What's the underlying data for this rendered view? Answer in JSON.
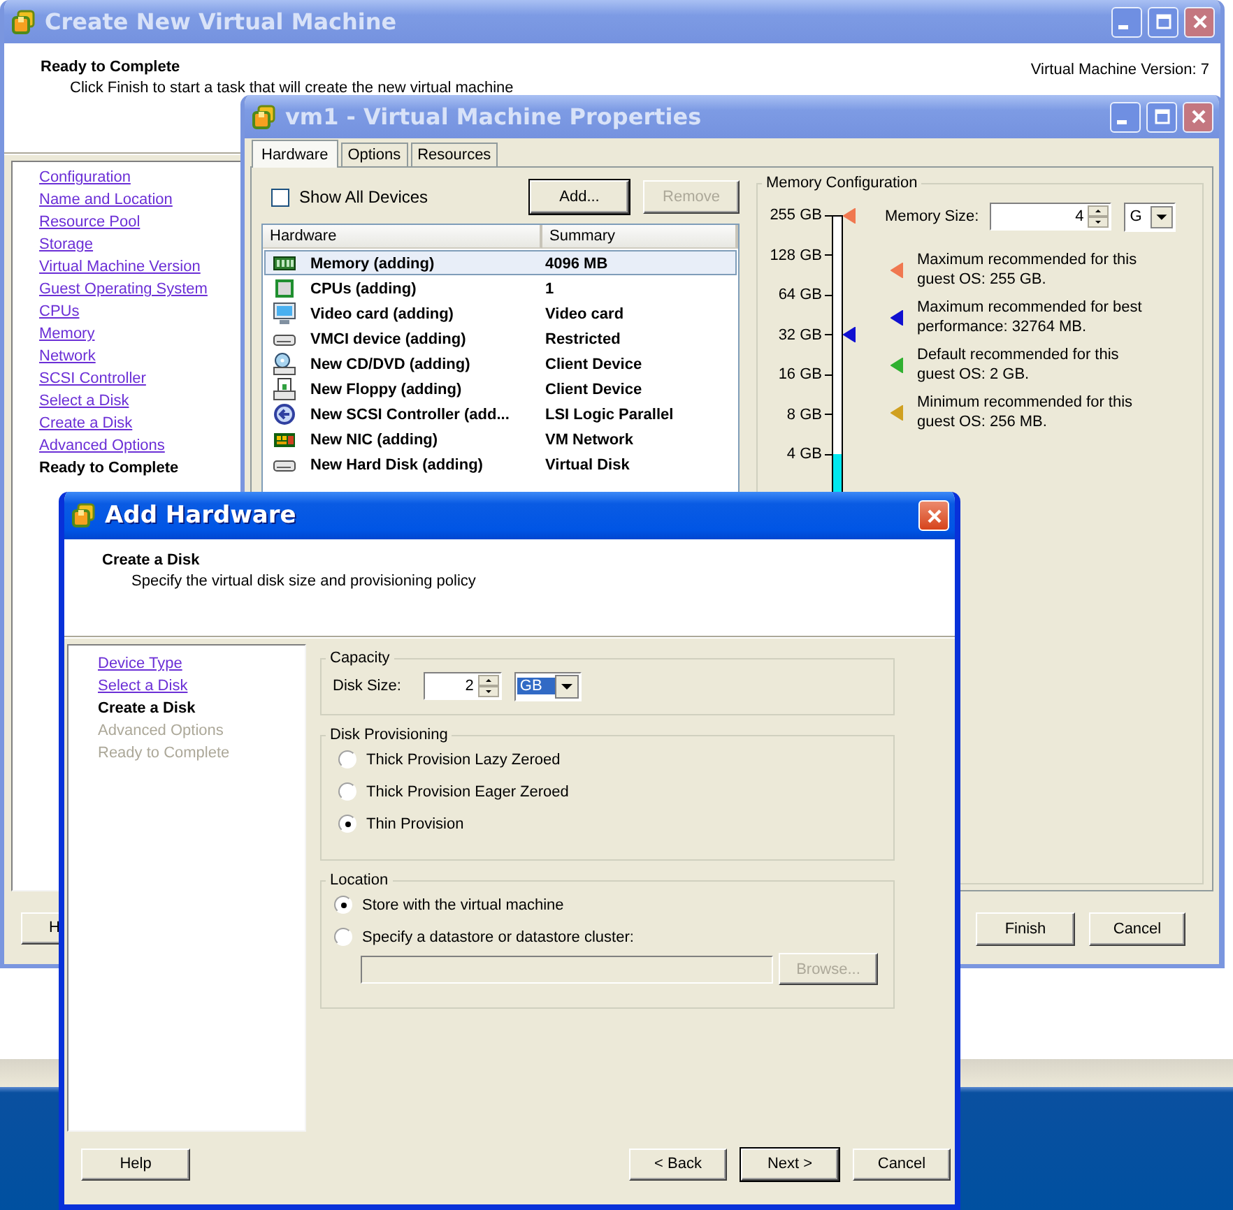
{
  "create_wizard": {
    "title": "Create New Virtual Machine",
    "active": false,
    "controls": [
      {
        "kind": "minimize"
      },
      {
        "kind": "maximize"
      },
      {
        "kind": "close"
      }
    ],
    "header": {
      "title": "Ready to Complete",
      "subtitle": "Click Finish to start a task that will create the new virtual machine",
      "version": "Virtual Machine Version: 7"
    },
    "steps": [
      {
        "label": "Configuration",
        "selected": false,
        "disabled": false
      },
      {
        "label": "Name and Location",
        "selected": false,
        "disabled": false
      },
      {
        "label": "Resource Pool",
        "selected": false,
        "disabled": false
      },
      {
        "label": "Storage",
        "selected": false,
        "disabled": false
      },
      {
        "label": "Virtual Machine Version",
        "selected": false,
        "disabled": false
      },
      {
        "label": "Guest Operating System",
        "selected": false,
        "disabled": false
      },
      {
        "label": "CPUs",
        "selected": false,
        "disabled": false
      },
      {
        "label": "Memory",
        "selected": false,
        "disabled": false
      },
      {
        "label": "Network",
        "selected": false,
        "disabled": false
      },
      {
        "label": "SCSI Controller",
        "selected": false,
        "disabled": false
      },
      {
        "label": "Select a Disk",
        "selected": false,
        "disabled": false
      },
      {
        "label": "Create a Disk",
        "selected": false,
        "disabled": false
      },
      {
        "label": "Advanced Options",
        "selected": false,
        "disabled": false
      },
      {
        "label": "Ready to Complete",
        "selected": true,
        "disabled": false
      }
    ],
    "buttons": [
      {
        "label": "H",
        "disabled": false,
        "default": false
      }
    ]
  },
  "properties": {
    "title": "vm1 - Virtual Machine Properties",
    "active": false,
    "controls": [
      {
        "kind": "minimize"
      },
      {
        "kind": "maximize"
      },
      {
        "kind": "close"
      }
    ],
    "tabs": [
      {
        "label": "Hardware",
        "selected": true
      },
      {
        "label": "Options",
        "selected": false
      },
      {
        "label": "Resources",
        "selected": false
      }
    ],
    "show_all_devices": {
      "label": "Show All Devices",
      "checked": false
    },
    "add_button": {
      "label": "Add...",
      "disabled": false,
      "default": true
    },
    "remove_button": {
      "label": "Remove",
      "disabled": true,
      "default": false
    },
    "table": {
      "columns": [
        "Hardware",
        "Summary"
      ],
      "rows": [
        {
          "kind": "memory",
          "hardware": "Memory (adding)",
          "summary": "4096 MB",
          "selected": true
        },
        {
          "kind": "cpu",
          "hardware": "CPUs (adding)",
          "summary": "1",
          "selected": false
        },
        {
          "kind": "video",
          "hardware": "Video card  (adding)",
          "summary": "Video card",
          "selected": false
        },
        {
          "kind": "vmci",
          "hardware": "VMCI device (adding)",
          "summary": "Restricted",
          "selected": false
        },
        {
          "kind": "cdrom",
          "hardware": "New CD/DVD (adding)",
          "summary": "Client Device",
          "selected": false
        },
        {
          "kind": "floppy",
          "hardware": "New Floppy (adding)",
          "summary": "Client Device",
          "selected": false
        },
        {
          "kind": "scsi",
          "hardware": "New SCSI Controller (add...",
          "summary": "LSI Logic Parallel",
          "selected": false
        },
        {
          "kind": "nic",
          "hardware": "New NIC (adding)",
          "summary": "VM Network",
          "selected": false
        },
        {
          "kind": "disk",
          "hardware": "New Hard Disk (adding)",
          "summary": "Virtual Disk",
          "selected": false
        }
      ]
    },
    "memory": {
      "title": "Memory Configuration",
      "ticks": [
        {
          "label": "255 GB",
          "color": "#f07850"
        },
        {
          "label": "128 GB"
        },
        {
          "label": "64 GB"
        },
        {
          "label": "32 GB",
          "color": "#1010d0"
        },
        {
          "label": "16 GB"
        },
        {
          "label": "8 GB"
        },
        {
          "label": "4 GB"
        }
      ],
      "level": 0.15,
      "size_label": "Memory Size:",
      "size_value": "4",
      "unit": "G",
      "legend": [
        {
          "text": "Maximum recommended for this guest OS: 255 GB.",
          "color": "#f07850"
        },
        {
          "text": "Maximum recommended for best performance: 32764 MB.",
          "color": "#1010d0"
        },
        {
          "text": "Default recommended for this guest OS: 2 GB.",
          "color": "#30b030"
        },
        {
          "text": "Minimum recommended for this guest OS: 256 MB.",
          "color": "#d0a020"
        }
      ]
    },
    "buttons": [
      {
        "label": "Finish",
        "disabled": false,
        "default": false
      },
      {
        "label": "Cancel",
        "disabled": false,
        "default": false
      }
    ]
  },
  "add_hardware": {
    "title": "Add Hardware",
    "active": true,
    "controls": [
      {
        "kind": "close"
      }
    ],
    "header": {
      "title": "Create a Disk",
      "subtitle": "Specify the virtual disk size and provisioning policy"
    },
    "steps": [
      {
        "label": "Device Type",
        "selected": false,
        "disabled": false
      },
      {
        "label": "Select a Disk",
        "selected": false,
        "disabled": false
      },
      {
        "label": "Create a Disk",
        "selected": true,
        "disabled": false
      },
      {
        "label": "Advanced Options",
        "selected": false,
        "disabled": true
      },
      {
        "label": "Ready to Complete",
        "selected": false,
        "disabled": true
      }
    ],
    "capacity": {
      "title": "Capacity",
      "label": "Disk Size:",
      "value": "2",
      "unit": "GB"
    },
    "provisioning": {
      "title": "Disk Provisioning",
      "options": [
        {
          "label": "Thick Provision Lazy Zeroed",
          "selected": false
        },
        {
          "label": "Thick Provision Eager Zeroed",
          "selected": false
        },
        {
          "label": "Thin Provision",
          "selected": true
        }
      ]
    },
    "location": {
      "title": "Location",
      "options": [
        {
          "label": "Store with the virtual machine",
          "selected": true
        },
        {
          "label": "Specify a datastore or datastore cluster:",
          "selected": false
        }
      ],
      "datastore_field": {
        "disabled": true
      },
      "browse": {
        "label": "Browse...",
        "disabled": true,
        "default": false
      }
    },
    "buttons": [
      {
        "label": "Help",
        "disabled": false,
        "default": false
      },
      {
        "label": "< Back",
        "disabled": false,
        "default": false
      },
      {
        "label": "Next >",
        "disabled": false,
        "default": true
      },
      {
        "label": "Cancel",
        "disabled": false,
        "default": false
      }
    ]
  }
}
